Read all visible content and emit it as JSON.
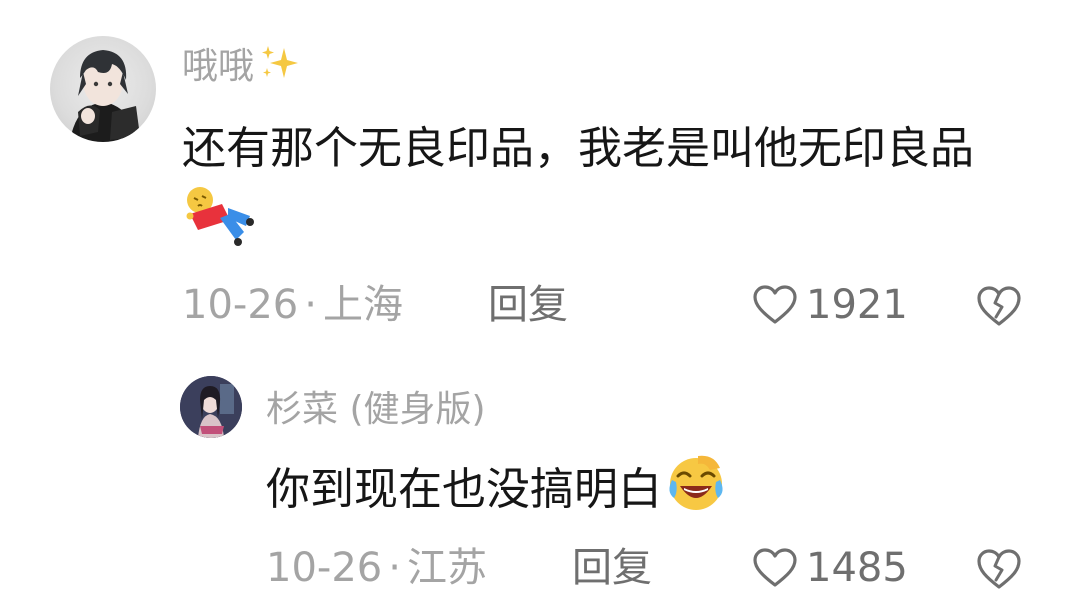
{
  "comments": [
    {
      "username": "哦哦",
      "sparkle_icon": "sparkles-icon",
      "text": "还有那个无良印品，我老是叫他无印良品",
      "text_emoji": "lying-doll-icon",
      "date": "10-26",
      "separator": "·",
      "location": "上海",
      "reply_label": "回复",
      "like_count": "1921"
    },
    {
      "username": "杉菜 (健身版)",
      "text": "你到现在也没搞明白",
      "text_emoji": "laughing-crying-emoji-icon",
      "date": "10-26",
      "separator": "·",
      "location": "江苏",
      "reply_label": "回复",
      "like_count": "1485"
    }
  ],
  "colors": {
    "meta": "#a4a4a4",
    "text": "#161616",
    "action": "#6f6f6f"
  }
}
